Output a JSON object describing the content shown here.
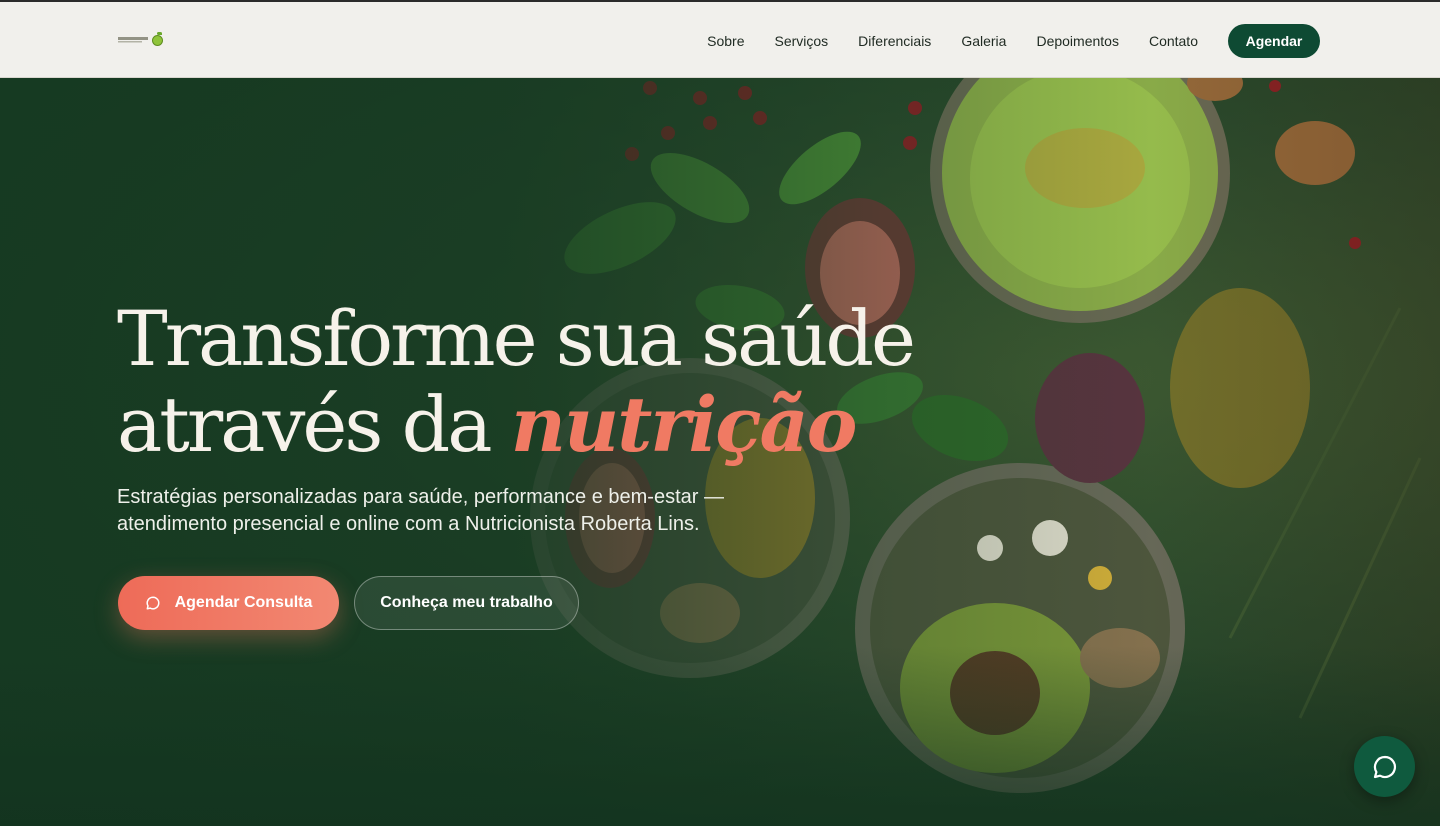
{
  "header": {
    "logo_alt": "Roberta Lins",
    "nav": [
      {
        "label": "Sobre"
      },
      {
        "label": "Serviços"
      },
      {
        "label": "Diferenciais"
      },
      {
        "label": "Galeria"
      },
      {
        "label": "Depoimentos"
      },
      {
        "label": "Contato"
      }
    ],
    "cta_label": "Agendar"
  },
  "hero": {
    "headline_line1": "Transforme sua saúde",
    "headline_line2_prefix": "através da ",
    "headline_accent": "nutrição",
    "subtitle": "Estratégias personalizadas para saúde, performance e bem-estar — atendimento presencial e online com a Nutricionista Roberta Lins.",
    "primary_button": {
      "label": "Agendar Consulta",
      "icon": "chat-bubble-icon"
    },
    "secondary_button": {
      "label": "Conheça meu trabalho"
    }
  },
  "chat_fab": {
    "icon": "chat-bubble-icon"
  },
  "colors": {
    "header_bg": "#f1f0ec",
    "brand_green": "#0e4a33",
    "accent_coral": "#f07a63",
    "hero_green": "#1d3d24"
  }
}
